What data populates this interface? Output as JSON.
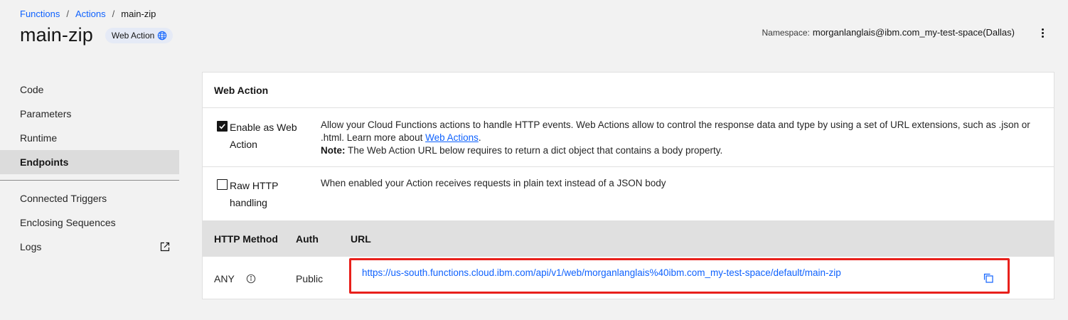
{
  "breadcrumb": {
    "items": [
      {
        "label": "Functions"
      },
      {
        "label": "Actions"
      }
    ],
    "separator": "/",
    "current": "main-zip"
  },
  "page": {
    "title": "main-zip",
    "tag_label": "Web Action",
    "tag_icon": "globe-icon"
  },
  "namespace": {
    "label": "Namespace:",
    "value": "morganlanglais@ibm.com_my-test-space(Dallas)"
  },
  "sidebar": {
    "items": [
      {
        "label": "Code"
      },
      {
        "label": "Parameters"
      },
      {
        "label": "Runtime"
      },
      {
        "label": "Endpoints",
        "active": true
      }
    ],
    "items2": [
      {
        "label": "Connected Triggers"
      },
      {
        "label": "Enclosing Sequences"
      },
      {
        "label": "Logs",
        "icon": "external-link-icon"
      }
    ]
  },
  "panel": {
    "header": "Web Action",
    "options": [
      {
        "label": "Enable as Web Action",
        "checked": true,
        "desc_before_link": "Allow your Cloud Functions actions to handle HTTP events. Web Actions allow to control the response data and type by using a set of URL extensions, such as .json or .html. Learn more about ",
        "link_text": "Web Actions",
        "desc_after_link": ".",
        "note_label": "Note:",
        "note_text": " The Web Action URL below requires to return a dict object that contains a body property."
      },
      {
        "label": "Raw HTTP handling",
        "checked": false,
        "desc": "When enabled your Action receives requests in plain text instead of a JSON body"
      }
    ],
    "table": {
      "headers": {
        "method": "HTTP Method",
        "auth": "Auth",
        "url": "URL"
      },
      "rows": [
        {
          "method": "ANY",
          "auth": "Public",
          "url": "https://us-south.functions.cloud.ibm.com/api/v1/web/morganlanglais%40ibm.com_my-test-space/default/main-zip"
        }
      ]
    }
  },
  "colors": {
    "link": "#0f62fe",
    "highlight_box": "#e8201b",
    "active_nav": "#dcdcdc",
    "tag_bg": "#e5eaf6"
  }
}
